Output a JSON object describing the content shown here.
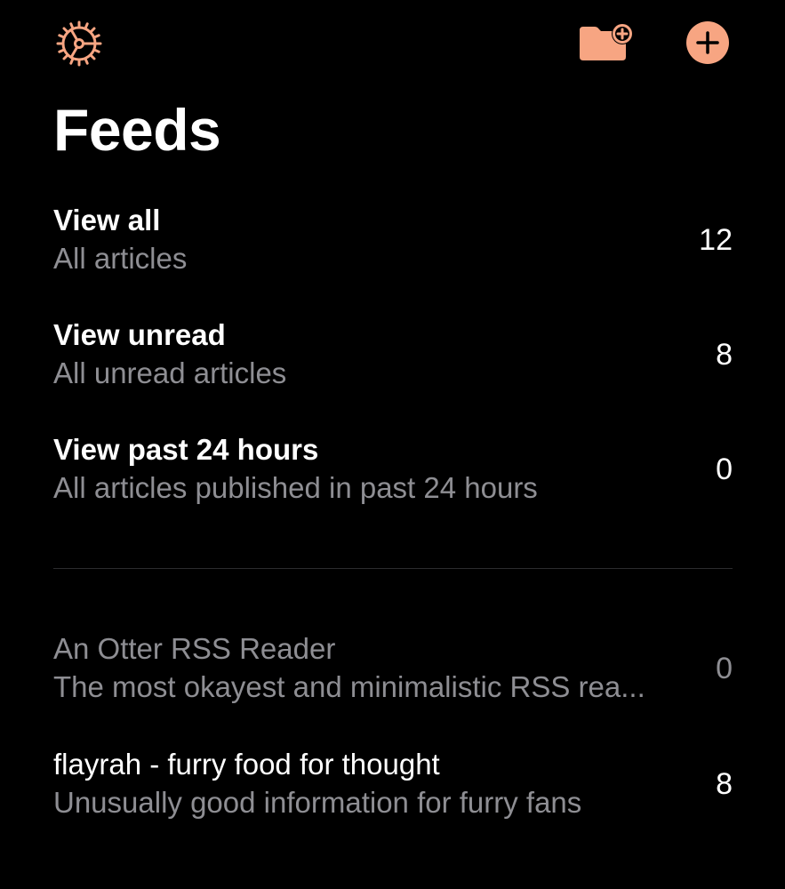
{
  "theme": {
    "accent": "#f7a582",
    "background": "#000000",
    "text_primary": "#ffffff",
    "text_secondary": "#8e8e93"
  },
  "toolbar": {
    "settings_icon": "gear-icon",
    "new_folder_icon": "folder-plus-icon",
    "add_feed_icon": "plus-circle-icon"
  },
  "page": {
    "title": "Feeds"
  },
  "smart_feeds": [
    {
      "title": "View all",
      "subtitle": "All articles",
      "count": "12"
    },
    {
      "title": "View unread",
      "subtitle": "All unread articles",
      "count": "8"
    },
    {
      "title": "View past 24 hours",
      "subtitle": "All articles published in past 24 hours",
      "count": "0"
    }
  ],
  "feeds": [
    {
      "title": "An Otter RSS Reader",
      "subtitle": "The most okayest and minimalistic RSS rea...",
      "count": "0"
    },
    {
      "title": "flayrah - furry food for thought",
      "subtitle": "Unusually good information for furry fans",
      "count": "8"
    }
  ]
}
